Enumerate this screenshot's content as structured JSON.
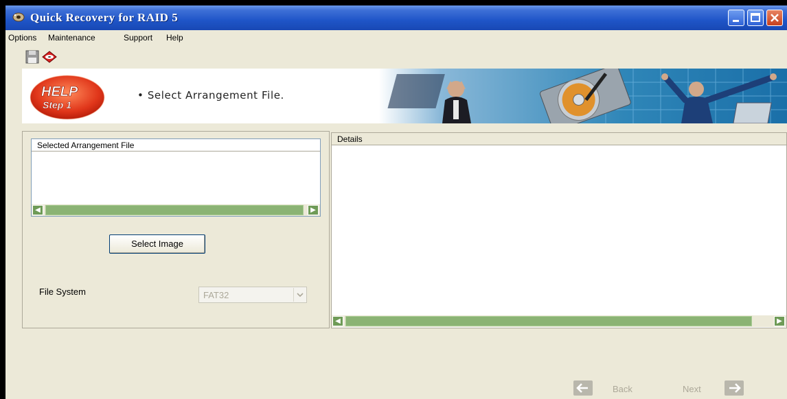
{
  "window": {
    "title": "Quick Recovery for RAID 5"
  },
  "menu": [
    "Options",
    "Maintenance",
    "Support",
    "Help"
  ],
  "toolbar": {
    "icons": [
      "save-icon",
      "recovery-icon"
    ]
  },
  "banner": {
    "help_label": "HELP",
    "step_label": "Step 1",
    "instruction": "• Select Arrangement File."
  },
  "left_panel": {
    "list_header": "Selected Arrangement File",
    "select_button": "Select Image",
    "file_system_label": "File System",
    "file_system_value": "FAT32"
  },
  "details_panel": {
    "header": "Details"
  },
  "navigation": {
    "back_label": "Back",
    "next_label": "Next"
  },
  "colors": {
    "titlebar": "#1f55c8",
    "window_bg": "#ece9d8",
    "scrollbar": "#6f9b57",
    "help_badge": "#e0361a"
  }
}
